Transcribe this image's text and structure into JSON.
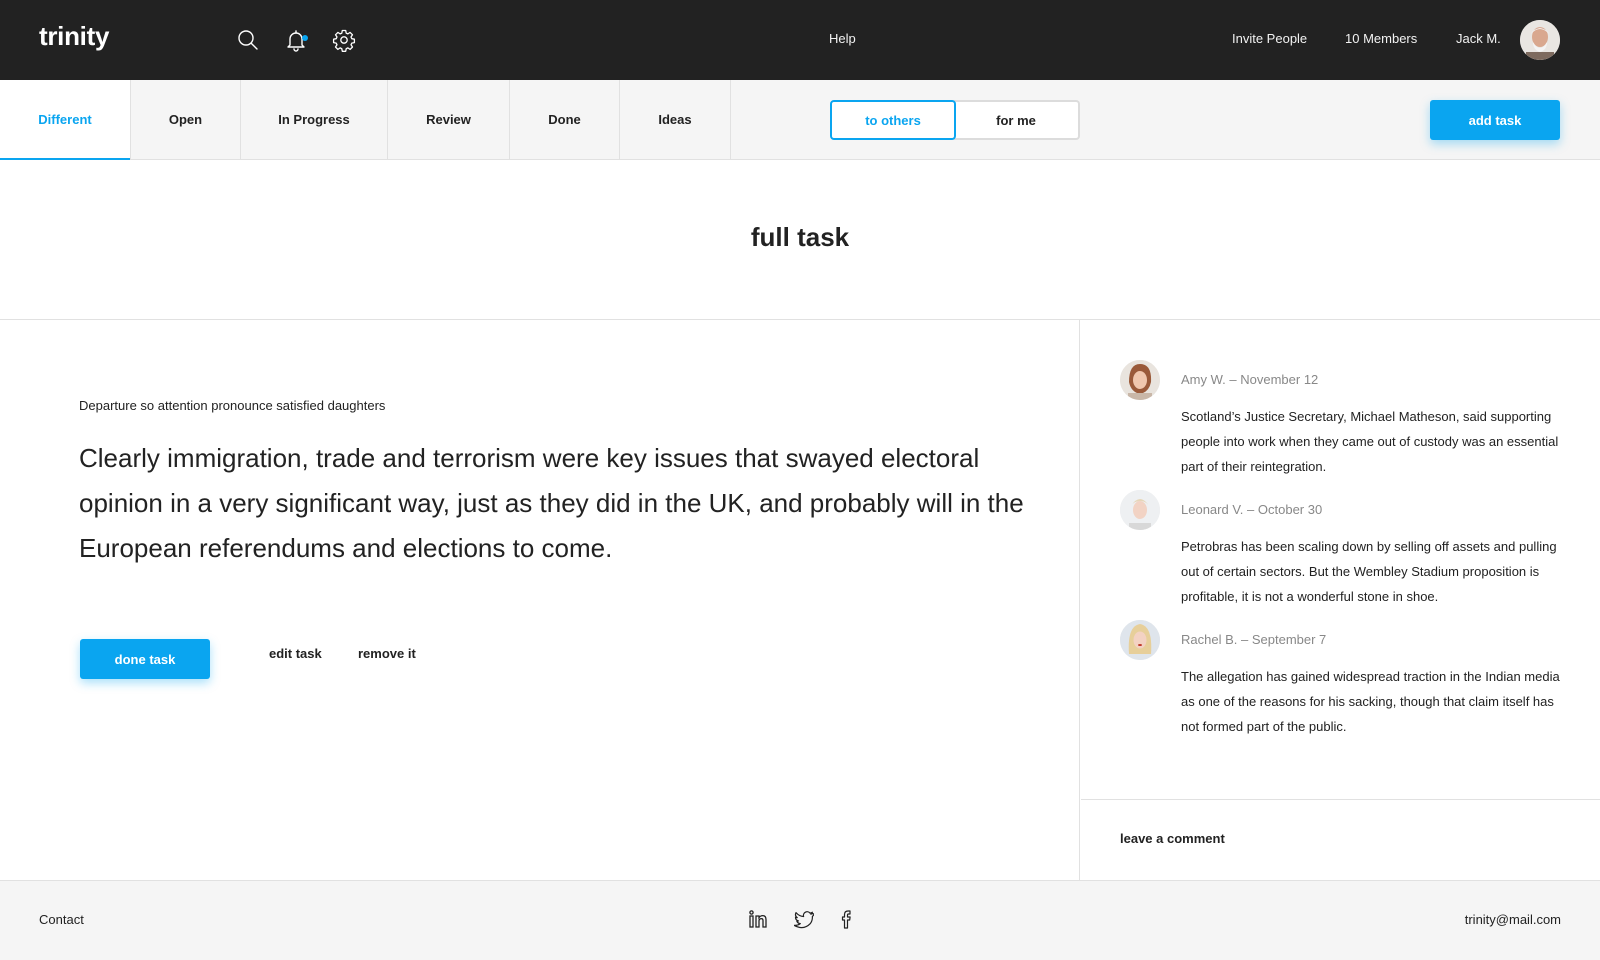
{
  "app": {
    "logo": "trinity"
  },
  "header": {
    "icons": {
      "search": "search-icon",
      "notifications": "bell-icon",
      "settings": "gear-icon"
    },
    "help": "Help",
    "invite": "Invite People",
    "members": "10 Members",
    "user": "Jack M."
  },
  "tabs": [
    {
      "label": "Different",
      "active": true
    },
    {
      "label": "Open"
    },
    {
      "label": "In Progress"
    },
    {
      "label": "Review"
    },
    {
      "label": "Done"
    },
    {
      "label": "Ideas"
    }
  ],
  "filter": {
    "to_others": "to others",
    "for_me": "for me",
    "selected": "to others"
  },
  "add_task": "add task",
  "page": {
    "title": "full task"
  },
  "task": {
    "subtitle": "Departure so attention pronounce satisfied daughters",
    "body": "Clearly immigration, trade and terrorism were key issues that swayed electoral opinion in a very significant way, just as they did in the UK, and probably will in the European referendums and elections to come.",
    "done": "done task",
    "edit": "edit task",
    "remove": "remove it"
  },
  "comments": [
    {
      "author": "Amy W.",
      "separator": " – ",
      "date": "November 12",
      "text": "Scotland’s Justice Secretary, Michael Matheson, said supporting people into work when they came out of custody was an essential part of their reintegration."
    },
    {
      "author": "Leonard V.",
      "separator": " – ",
      "date": "October 30",
      "text": "Petrobras has been scaling down by selling off assets and pulling out of certain sectors. But the Wembley Stadium proposition is profitable, it is not a wonderful stone in shoe."
    },
    {
      "author": "Rachel B.",
      "separator": " – ",
      "date": "September 7",
      "text": "The allegation has gained widespread traction in the Indian media as one of the reasons for his sacking, though that claim itself has not formed part of the public."
    }
  ],
  "leave_comment": "leave a comment",
  "footer": {
    "contact": "Contact",
    "email": "trinity@mail.com",
    "social": [
      "linkedin-icon",
      "twitter-icon",
      "facebook-icon"
    ]
  },
  "colors": {
    "accent": "#0aa5f0",
    "header_bg": "#222222",
    "bar_bg": "#f5f5f5",
    "border": "#e1e1e1"
  }
}
